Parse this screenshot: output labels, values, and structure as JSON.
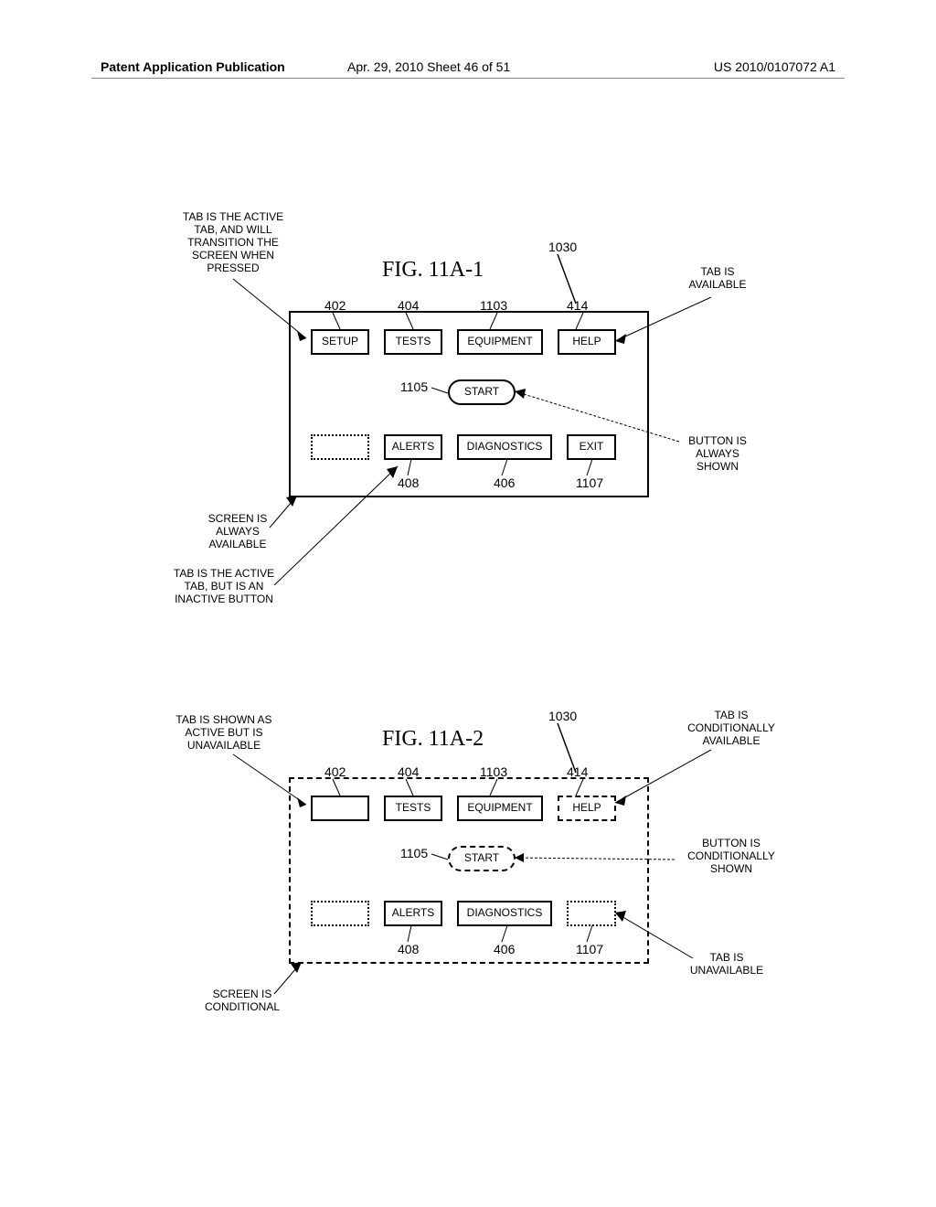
{
  "header": {
    "left": "Patent Application Publication",
    "mid": "Apr. 29, 2010  Sheet 46 of 51",
    "right": "US 2010/0107072 A1"
  },
  "fig1": {
    "title": "FIG. 11A-1",
    "ref_panel": "1030",
    "tabs": {
      "setup": {
        "label": "SETUP",
        "ref": "402"
      },
      "tests": {
        "label": "TESTS",
        "ref": "404"
      },
      "equipment": {
        "label": "EQUIPMENT",
        "ref": "1103"
      },
      "help": {
        "label": "HELP",
        "ref": "414"
      }
    },
    "start": {
      "label": "START",
      "ref": "1105"
    },
    "bottom": {
      "alerts": {
        "label": "ALERTS",
        "ref": "408"
      },
      "diagnostics": {
        "label": "DIAGNOSTICS",
        "ref": "406"
      },
      "exit": {
        "label": "EXIT",
        "ref": "1107"
      }
    },
    "notes": {
      "top_left": "TAB IS THE ACTIVE\nTAB, AND WILL\nTRANSITION THE\nSCREEN WHEN\nPRESSED",
      "tab_avail": "TAB IS\nAVAILABLE",
      "button_always": "BUTTON IS\nALWAYS\nSHOWN",
      "screen_always": "SCREEN IS\nALWAYS\nAVAILABLE",
      "inactive_btn": "TAB IS THE ACTIVE\nTAB, BUT IS AN\nINACTIVE BUTTON"
    }
  },
  "fig2": {
    "title": "FIG. 11A-2",
    "ref_panel": "1030",
    "tabs": {
      "setup": {
        "label": "",
        "ref": "402"
      },
      "tests": {
        "label": "TESTS",
        "ref": "404"
      },
      "equipment": {
        "label": "EQUIPMENT",
        "ref": "1103"
      },
      "help": {
        "label": "HELP",
        "ref": "414"
      }
    },
    "start": {
      "label": "START",
      "ref": "1105"
    },
    "bottom": {
      "alerts": {
        "label": "ALERTS",
        "ref": "408"
      },
      "diagnostics": {
        "label": "DIAGNOSTICS",
        "ref": "406"
      },
      "exit": {
        "label": "",
        "ref": "1107"
      }
    },
    "notes": {
      "shown_active_unavail": "TAB IS SHOWN AS\nACTIVE BUT IS\nUNAVAILABLE",
      "cond_avail": "TAB IS\nCONDITIONALLY\nAVAILABLE",
      "button_cond": "BUTTON IS\nCONDITIONALLY\nSHOWN",
      "tab_unavail": "TAB IS\nUNAVAILABLE",
      "screen_cond": "SCREEN IS\nCONDITIONAL"
    }
  }
}
